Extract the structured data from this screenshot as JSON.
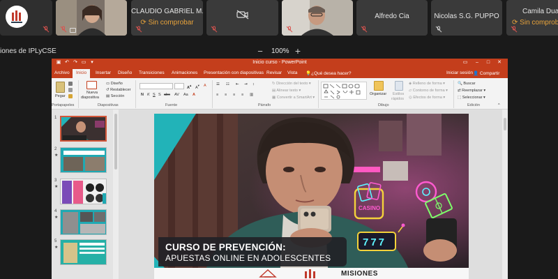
{
  "participants": [
    {
      "name": "",
      "muted": true
    },
    {
      "name": "",
      "muted": true,
      "video": true
    },
    {
      "name": "CLAUDIO GABRIEL M...",
      "status": "Sin comprobar",
      "muted": true
    },
    {
      "name": "",
      "muted": true,
      "video_off": true
    },
    {
      "name": "",
      "muted": true,
      "video": true
    },
    {
      "name": "Alfredo Cia",
      "muted": true
    },
    {
      "name": "Nicolas S.G. PUPPO",
      "muted": true
    },
    {
      "name": "Camila Duart",
      "status": "Sin comprobar",
      "muted": true
    }
  ],
  "screen_share": {
    "title": "iones de IPLyCSE",
    "zoom": {
      "minus": "−",
      "label": "100%",
      "plus": "+"
    }
  },
  "ppt": {
    "window_title": "Inicio curso  -  PowerPoint",
    "menu_tabs": [
      "Archivo",
      "Inicio",
      "Insertar",
      "Diseño",
      "Transiciones",
      "Animaciones",
      "Presentación con diapositivas",
      "Revisar",
      "Vista",
      "¿Qué desea hacer?"
    ],
    "active_tab": "Inicio",
    "account": {
      "signin": "Iniciar sesión",
      "share": "Compartir"
    },
    "groups": {
      "portapapeles": "Portapapeles",
      "diapositivas": "Diapositivas",
      "fuente": "Fuente",
      "parrafo": "Párrafo",
      "dibujo": "Dibujo",
      "edicion": "Edición"
    },
    "ribbon": {
      "pegar": "Pegar",
      "nueva": "Nueva",
      "diapositiva": "diapositiva",
      "diseno": "Diseño",
      "restablecer": "Restablecer",
      "seccion": "Sección",
      "direccion_texto": "Dirección del texto",
      "alinear_texto": "Alinear texto",
      "convertir_smartart": "Convertir a SmartArt",
      "organizar": "Organizar",
      "estilos": "Estilos",
      "rapidos": "rápidos",
      "relleno": "Relleno de forma",
      "contorno": "Contorno de forma",
      "efectos": "Efectos de forma",
      "buscar": "Buscar",
      "reemplazar": "Reemplazar",
      "seleccionar": "Seleccionar"
    },
    "thumbnails": [
      {
        "num": "1",
        "selected": true
      },
      {
        "num": "2"
      },
      {
        "num": "3"
      },
      {
        "num": "4"
      },
      {
        "num": "5"
      }
    ]
  },
  "slide": {
    "headline": "CURSO DE PREVENCIÓN:",
    "subheadline": "APUESTAS ONLINE EN ADOLESCENTES",
    "footer_brand": "MISIONES",
    "neon_casino": "CASINO",
    "slot_digits": "777"
  },
  "colors": {
    "ppt_accent": "#c43e1c",
    "status_orange": "#e8a33a",
    "mic_muted": "#d9534f",
    "slide_teal": "#22b3b8"
  }
}
